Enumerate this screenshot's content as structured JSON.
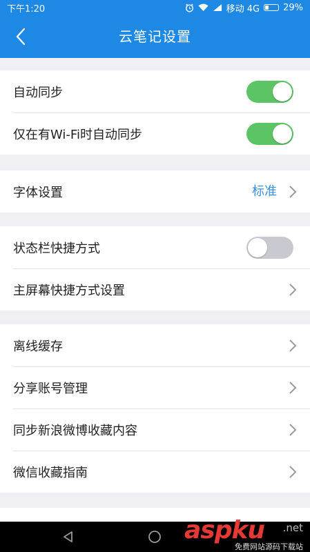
{
  "status_bar": {
    "time": "下午1:20",
    "carrier": "移动 4G",
    "battery": "29%",
    "battery_level": 0.29
  },
  "nav": {
    "title": "云笔记设置",
    "back_icon": "chevron-left-icon"
  },
  "groups": [
    [
      {
        "label": "自动同步",
        "control": "toggle",
        "on": true
      },
      {
        "label": "仅在有Wi-Fi时自动同步",
        "control": "toggle",
        "on": true
      }
    ],
    [
      {
        "label": "字体设置",
        "value": "标准",
        "control": "chevron"
      }
    ],
    [
      {
        "label": "状态栏快捷方式",
        "control": "toggle",
        "on": false
      },
      {
        "label": "主屏幕快捷方式设置",
        "control": "chevron"
      }
    ],
    [
      {
        "label": "离线缓存",
        "control": "chevron"
      },
      {
        "label": "分享账号管理",
        "control": "chevron"
      },
      {
        "label": "同步新浪微博收藏内容",
        "control": "chevron"
      },
      {
        "label": "微信收藏指南",
        "control": "chevron"
      }
    ]
  ],
  "watermark": {
    "main": "aspku",
    "net": ".net",
    "sub": "免费网站源码下载站"
  },
  "colors": {
    "accent": "#1e88e5",
    "toggle_on": "#5cc465",
    "toggle_off": "#c9c9d1",
    "value_text": "#3a8fdd",
    "background": "#efeff4"
  }
}
